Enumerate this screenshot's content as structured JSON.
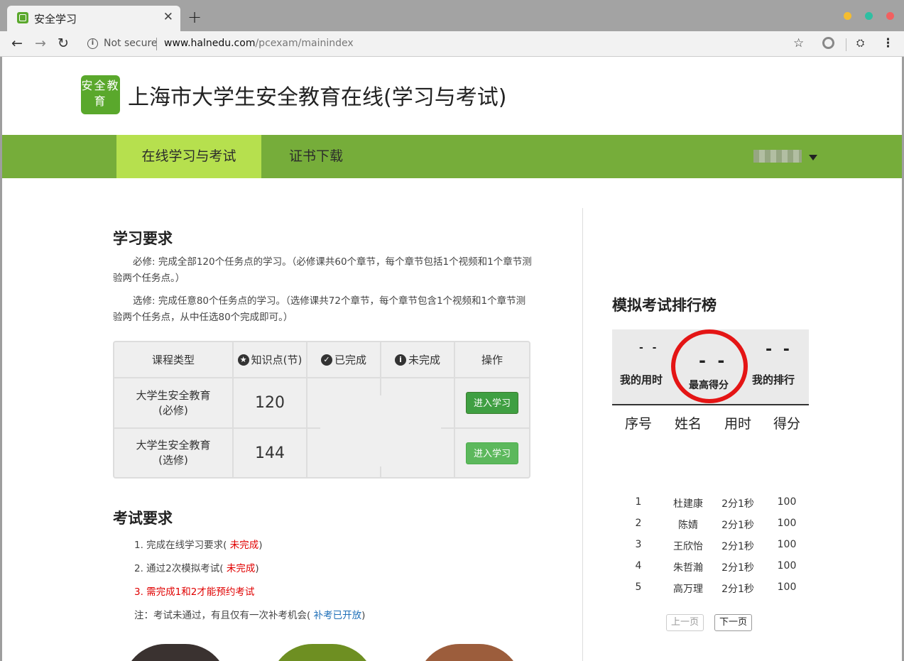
{
  "browser": {
    "tab_title": "安全学习",
    "tab_close": "✕",
    "new_tab": "+",
    "not_secure": "Not secure",
    "url_host": "www.halnedu.com",
    "url_path": "/pcexam/mainindex"
  },
  "site": {
    "logo_text": "安全教育",
    "title": "上海市大学生安全教育在线(学习与考试)"
  },
  "nav": {
    "items": [
      {
        "label": "在线学习与考试",
        "active": true
      },
      {
        "label": "证书下载",
        "active": false
      }
    ]
  },
  "study": {
    "heading": "学习要求",
    "required_text": "必修: 完成全部120个任务点的学习。（必修课共60个章节，每个章节包括1个视频和1个章节测验两个任务点。）",
    "elective_text": "选修: 完成任意80个任务点的学习。（选修课共72个章节，每个章节包含1个视频和1个章节测验两个任务点，从中任选80个完成即可。）",
    "table": {
      "headers": [
        "课程类型",
        "知识点(节)",
        "已完成",
        "未完成",
        "操作"
      ],
      "rows": [
        {
          "type_line1": "大学生安全教育",
          "type_line2": "(必修)",
          "points": "120",
          "done": "",
          "undone": "",
          "action": "进入学习"
        },
        {
          "type_line1": "大学生安全教育",
          "type_line2": "(选修)",
          "points": "144",
          "done": "",
          "undone": "",
          "action": "进入学习"
        }
      ]
    }
  },
  "exam": {
    "heading": "考试要求",
    "item1_prefix": "1. 完成在线学习要求(",
    "item1_status": " 未完成",
    "item1_suffix": ")",
    "item2_prefix": "2. 通过2次模拟考试(",
    "item2_status": " 未完成",
    "item2_suffix": ")",
    "item3": "3. 需完成1和2才能预约考试",
    "note_prefix": "注：考试未通过，有且仅有一次补考机会(",
    "note_link": " 补考已开放",
    "note_suffix": ")"
  },
  "ranking": {
    "title": "模拟考试排行榜",
    "my_time_value": "- -",
    "my_time_label": "我的用时",
    "best_score_value": "- -",
    "best_score_label": "最高得分",
    "my_rank_value": "- -",
    "my_rank_label": "我的排行",
    "headers": [
      "序号",
      "姓名",
      "用时",
      "得分"
    ],
    "rows": [
      {
        "no": "1",
        "name": "杜建康",
        "time": "2分1秒",
        "score": "100"
      },
      {
        "no": "2",
        "name": "陈婧",
        "time": "2分1秒",
        "score": "100"
      },
      {
        "no": "3",
        "name": "王欣怡",
        "time": "2分1秒",
        "score": "100"
      },
      {
        "no": "4",
        "name": "朱哲瀚",
        "time": "2分1秒",
        "score": "100"
      },
      {
        "no": "5",
        "name": "高万理",
        "time": "2分1秒",
        "score": "100"
      }
    ],
    "prev_page": "上一页",
    "next_page": "下一页"
  },
  "colors": {
    "brand_green": "#76ad3a",
    "nav_active": "#b6e04e",
    "button_green": "#3f9f42",
    "status_red": "#e00000",
    "link_blue": "#1e6fb8",
    "highlight_ring": "#e41515"
  }
}
